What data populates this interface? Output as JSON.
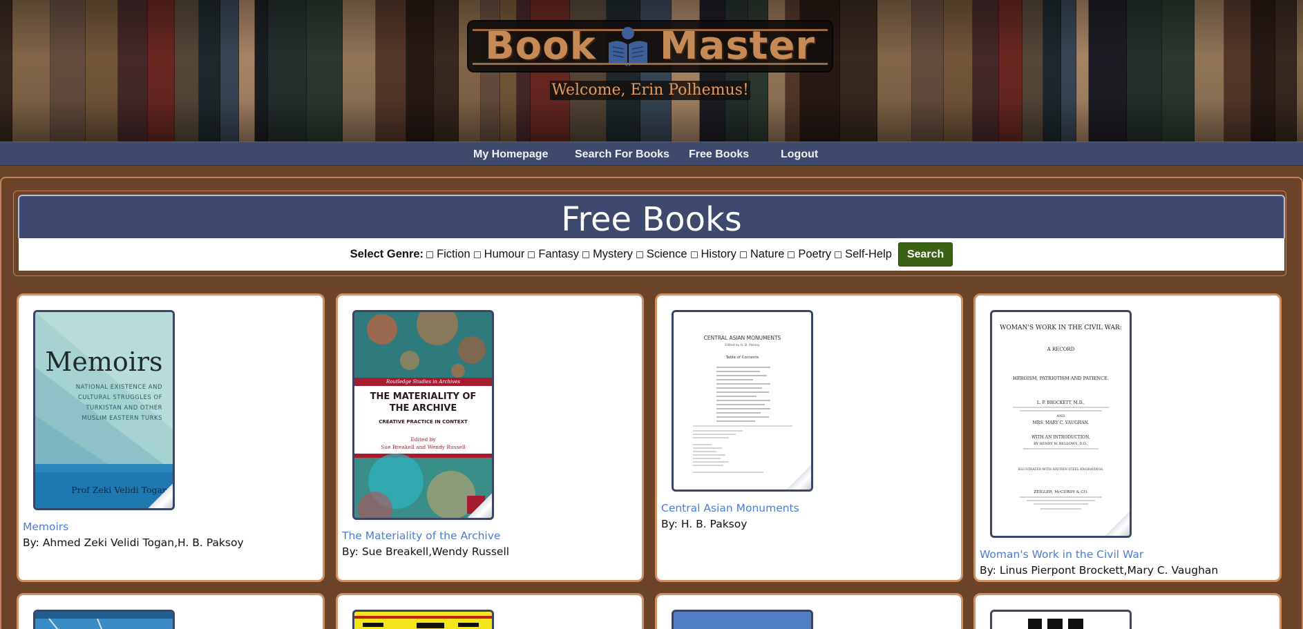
{
  "site": {
    "logo_left": "Book",
    "logo_right": "Master",
    "welcome": "Welcome, Erin Polhemus!"
  },
  "nav": {
    "items": [
      {
        "label": "My Homepage"
      },
      {
        "label": "Search For Books"
      },
      {
        "label": "Free Books"
      },
      {
        "label": "Logout"
      }
    ]
  },
  "page": {
    "title": "Free Books",
    "filter_label": "Select Genre:",
    "genres": [
      "Fiction",
      "Humour",
      "Fantasy",
      "Mystery",
      "Science",
      "History",
      "Nature",
      "Poetry",
      "Self-Help"
    ],
    "search_button": "Search"
  },
  "books": [
    {
      "title": "Memoirs",
      "authors": "By: Ahmed Zeki Velidi Togan,H. B. Paksoy",
      "cover": {
        "title": "Memoirs",
        "subtitle": "NATIONAL EXISTENCE AND CULTURAL STRUGGLES OF TURKISTAN AND OTHER MUSLIM EASTERN TURKS",
        "author": "Prof Zeki Velidi Togan"
      }
    },
    {
      "title": "The Materiality of the Archive",
      "authors": "By: Sue Breakell,Wendy Russell",
      "cover": {
        "series": "Routledge Studies in Archives",
        "title": "THE MATERIALITY OF THE ARCHIVE",
        "subtitle": "CREATIVE PRACTICE IN CONTEXT",
        "edited": "Edited by",
        "editors": "Sue Breakell and Wendy Russell"
      }
    },
    {
      "title": "Central Asian Monuments",
      "authors": "By: H. B. Paksoy",
      "cover": {
        "title": "CENTRAL ASIAN MONUMENTS",
        "edited": "Edited by H. B. Paksoy",
        "toc": "Table of Contents"
      }
    },
    {
      "title": "Woman's Work in the Civil War",
      "authors": "By: Linus Pierpont Brockett,Mary C. Vaughan",
      "cover": {
        "title": "WOMAN'S WORK IN THE CIVIL WAR:",
        "line2": "A RECORD",
        "line3": "HEROISM, PATRIOTISM AND PATIENCE.",
        "by": "L. P. BROCKETT, M.D.,",
        "and": "AND",
        "author2": "MRS. MARY C. VAUGHAN.",
        "intro": "WITH AN INTRODUCTION,",
        "intro_by": "BY HENRY W. BELLOWS, D.D.,",
        "illustrated": "ILLUSTRATED WITH SIXTEEN STEEL ENGRAVINGS.",
        "publisher": "ZEIGLER, McCURDY & CO."
      }
    }
  ],
  "colors": {
    "page_bg": "#6b4428",
    "nav_bg": "#3d4a6e",
    "accent_border": "#d49062",
    "link": "#4a7cd6",
    "button": "#3b6212"
  }
}
